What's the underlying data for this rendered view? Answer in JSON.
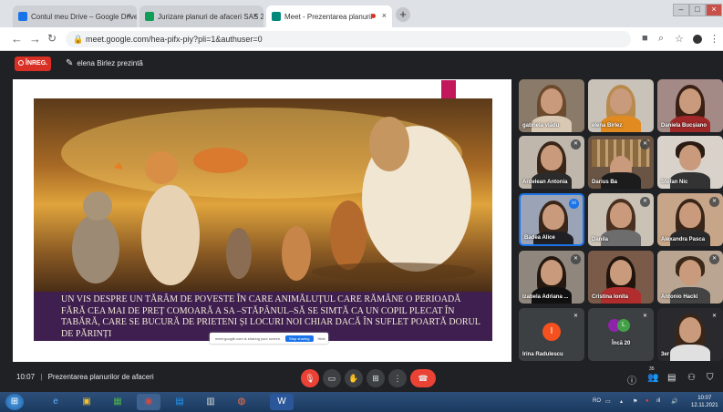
{
  "browser": {
    "tabs": [
      {
        "label": "Contul meu Drive – Google Drive",
        "close": "×",
        "icon_color": "#1a73e8"
      },
      {
        "label": "Jurizare planuri de afaceri SAS 2(",
        "close": "×",
        "icon_color": "#0f9d58"
      },
      {
        "label": "Meet - Prezentarea planuril",
        "close": "×",
        "icon_color": "#00897b"
      }
    ],
    "newtab": "+",
    "url": "meet.google.com/hea-pifx-piy?pli=1&authuser=0",
    "win_min": "–",
    "win_max": "□",
    "win_close": "×"
  },
  "meet": {
    "rec_label": "ÎNREG.",
    "presenter": "elena Birlez prezintă",
    "slide_text": "UN VIS DESPRE UN TĂRÂM DE POVESTE ÎN CARE ANIMĂLUȚUL CARE RĂMÂNE O PERIOADĂ FĂRĂ CEA MAI DE PREȚ COMOARĂ A SA –STĂPÂNUL–SĂ SE SIMTĂ CA UN COPIL PLECAT ÎN TABĂRĂ, CARE SE BUCURĂ DE PRIETENI ȘI LOCURI NOI CHIAR DACĂ ÎN SUFLET POARTĂ DORUL DE PĂRINȚI",
    "share_notice": "meet.google.com is sharing your screen.",
    "stop_sharing": "Stop sharing",
    "hide": "Hide",
    "participants": [
      {
        "name": "gabriela vlădu"
      },
      {
        "name": "elena Birlez"
      },
      {
        "name": "Daniela Bucșiano"
      },
      {
        "name": "Ardelean Antonia"
      },
      {
        "name": "Darius Ba"
      },
      {
        "name": "Stefan Nic"
      },
      {
        "name": "Badea Alice"
      },
      {
        "name": "Danila"
      },
      {
        "name": "Alexandra Pasca"
      },
      {
        "name": "Izabela Adriana ..."
      },
      {
        "name": "Cristina Ionita"
      },
      {
        "name": "Antonio Hacki"
      },
      {
        "name": "Irina Radulescu",
        "initial": "I"
      },
      {
        "name": "Încă 20",
        "initial": "L"
      },
      {
        "name": "3er"
      }
    ],
    "time": "10:07",
    "separator": "|",
    "meeting_title": "Prezentarea planurilor de afaceri",
    "participant_count": "35"
  },
  "taskbar": {
    "lang": "RO",
    "clock_time": "10:07",
    "clock_date": "12.11.2021"
  },
  "colors": {
    "red": "#ea4335",
    "meet_bg": "#202124",
    "slide_text_bg": "#3e1f4f"
  }
}
